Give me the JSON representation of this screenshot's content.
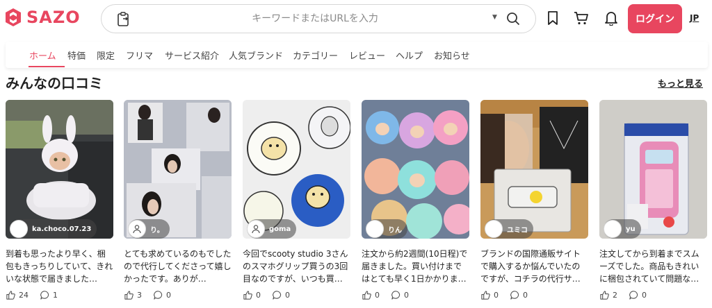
{
  "header": {
    "brand": "SAZO",
    "search_placeholder": "キーワードまたはURLを入力",
    "login_label": "ログイン",
    "lang_label": "JP",
    "colors": {
      "accent": "#e8465f"
    }
  },
  "nav": {
    "items": [
      "ホーム",
      "特価",
      "限定",
      "フリマ",
      "サービス紹介",
      "人気ブランド",
      "カテゴリー",
      "レビュー",
      "ヘルプ",
      "お知らせ"
    ],
    "active_index": 0
  },
  "section": {
    "title": "みんなの口コミ",
    "more_label": "もっと見る"
  },
  "reviews": [
    {
      "user": "ka.choco.07.23",
      "comment": "到着も思ったより早く、梱包もきっちりしていて、きれいな状態で届きました…",
      "likes": "24",
      "comments": "1",
      "photo": "plush-doll-car"
    },
    {
      "user": "り。",
      "comment": "とても求めているのもでしたので代行してくださって嬉しかったです。ありが…",
      "likes": "3",
      "comments": "0",
      "photo": "idol-photocards"
    },
    {
      "user": "goma",
      "comment": "今回でscooty studio 3さんのスマホグリップ買うの3回目なのですが、いつも買…",
      "likes": "0",
      "comments": "0",
      "photo": "phone-grips"
    },
    {
      "user": "りん",
      "comment": "注文から約2週間(10日程)で届きました。買い付けまではとても早く1日かかりま…",
      "likes": "0",
      "comments": "0",
      "photo": "colorful-plushies"
    },
    {
      "user": "ユミコ",
      "comment": "ブランドの国際通販サイトで購入するか悩んでいたのですが、コチラの代行サ…",
      "likes": "0",
      "comments": "0",
      "photo": "necklace-package"
    },
    {
      "user": "yu",
      "comment": "注文してから到着までスムーズでした。商品もきれいに梱包されていて問題な…",
      "likes": "2",
      "comments": "0",
      "photo": "label-printer"
    }
  ]
}
